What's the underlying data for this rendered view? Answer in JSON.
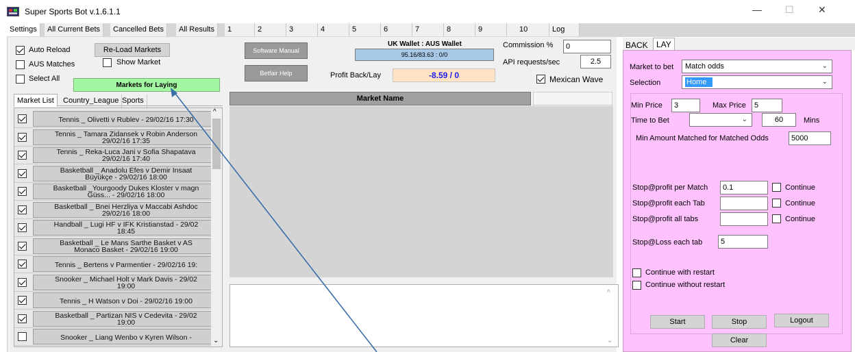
{
  "window": {
    "title": "Super Sports Bot v.1.6.1.1",
    "controls": {
      "minimize": "—",
      "maximize": "☐",
      "close": "✕"
    }
  },
  "tabs": [
    "Settings",
    "All Current Bets",
    "Cancelled Bets",
    "All Results",
    "1",
    "2",
    "3",
    "4",
    "5",
    "6",
    "7",
    "8",
    "9",
    "10",
    "Log"
  ],
  "left": {
    "auto_reload": "Auto Reload",
    "reload_markets": "Re-Load Markets",
    "aus_matches": "AUS Matches",
    "show_market": "Show Market",
    "select_all": "Select All",
    "markets_for_laying": "Markets for Laying",
    "subtabs": [
      "Market List",
      "Country_League",
      "Sports"
    ],
    "markets": [
      {
        "line1": "Tennis _ Olivetti v Rublev - 29/02/16 17:30",
        "line2": "",
        "checked": true
      },
      {
        "line1": "Tennis _ Tamara Zidansek v Robin Anderson",
        "line2": "29/02/16 17:35",
        "checked": true
      },
      {
        "line1": "Tennis _ Reka-Luca Jani v Sofia Shapatava",
        "line2": "29/02/16 17:40",
        "checked": true
      },
      {
        "line1": "Basketball _ Anadolu Efes v Demir Insaat",
        "line2": "Büyükçe - 29/02/16 18:00",
        "checked": true
      },
      {
        "line1": "Basketball _Yourgoody Dukes Kloster v magn",
        "line2": "Güss... - 29/02/16 18:00",
        "checked": true
      },
      {
        "line1": "Basketball _ Bnei Herzliya v Maccabi Ashdoc",
        "line2": "29/02/16 18:00",
        "checked": true
      },
      {
        "line1": "Handball _ Lugi HF v IFK Kristianstad - 29/02",
        "line2": "18:45",
        "checked": true
      },
      {
        "line1": "Basketball _ Le Mans Sarthe Basket v AS",
        "line2": "Monaco Basket - 29/02/16 19:00",
        "checked": true
      },
      {
        "line1": "Tennis _ Bertens v Parmentier - 29/02/16 19:",
        "line2": "",
        "checked": true
      },
      {
        "line1": "Snooker _ Michael Holt v Mark Davis - 29/02",
        "line2": "19:00",
        "checked": true
      },
      {
        "line1": "Tennis _ H Watson v Doi - 29/02/16 19:00",
        "line2": "",
        "checked": true
      },
      {
        "line1": "Basketball _ Partizan NIS v Cedevita - 29/02",
        "line2": "19:00",
        "checked": true
      },
      {
        "line1": "Snooker _ Liang Wenbo v Kyren Wilson -",
        "line2": "",
        "checked": false
      }
    ]
  },
  "middle": {
    "software_manual": "Software Manual",
    "betfair_help": "Betfair Help",
    "wallet_label": "UK Wallet : AUS Wallet",
    "wallet_value": "95.16/83.63  :  0/0",
    "profit_label": "Profit Back/Lay",
    "profit_value": "-8.59 / 0",
    "commission_label": "Commission %",
    "commission_value": "0",
    "api_label": "API requests/sec",
    "api_value": "2.5",
    "mexican_wave": "Mexican Wave",
    "market_name_header": "Market Name"
  },
  "right": {
    "tabs": [
      "BACK",
      "LAY"
    ],
    "market_to_bet_label": "Market to bet",
    "market_to_bet_value": "Match odds",
    "selection_label": "Selection",
    "selection_value": "Home",
    "min_price_label": "Min Price",
    "min_price_value": "3",
    "max_price_label": "Max Price",
    "max_price_value": "5",
    "time_to_bet_label": "Time to Bet",
    "time_to_bet_value": "60",
    "mins_label": "Mins",
    "min_amount_label": "Min Amount Matched for Matched Odds",
    "min_amount_value": "5000",
    "stop_profit_match_label": "Stop@profit per Match",
    "stop_profit_match_value": "0.1",
    "stop_profit_tab_label": "Stop@profit each Tab",
    "stop_profit_all_label": "Stop@profit all tabs",
    "continue_label": "Continue",
    "stop_loss_label": "Stop@Loss each tab",
    "stop_loss_value": "5",
    "continue_with_restart": "Continue with restart",
    "continue_without_restart": "Continue without restart",
    "start": "Start",
    "stop": "Stop",
    "logout": "Logout",
    "clear": "Clear"
  },
  "colors": {
    "lay_panel": "#ffc2ff",
    "markets_for_laying_bg": "#a3f7a3",
    "wallet_bg": "#a8c8e8",
    "profit_bg": "#ffe3c2",
    "selection_highlight": "#3399ff",
    "annotation_arrow": "#3a6ea8"
  }
}
